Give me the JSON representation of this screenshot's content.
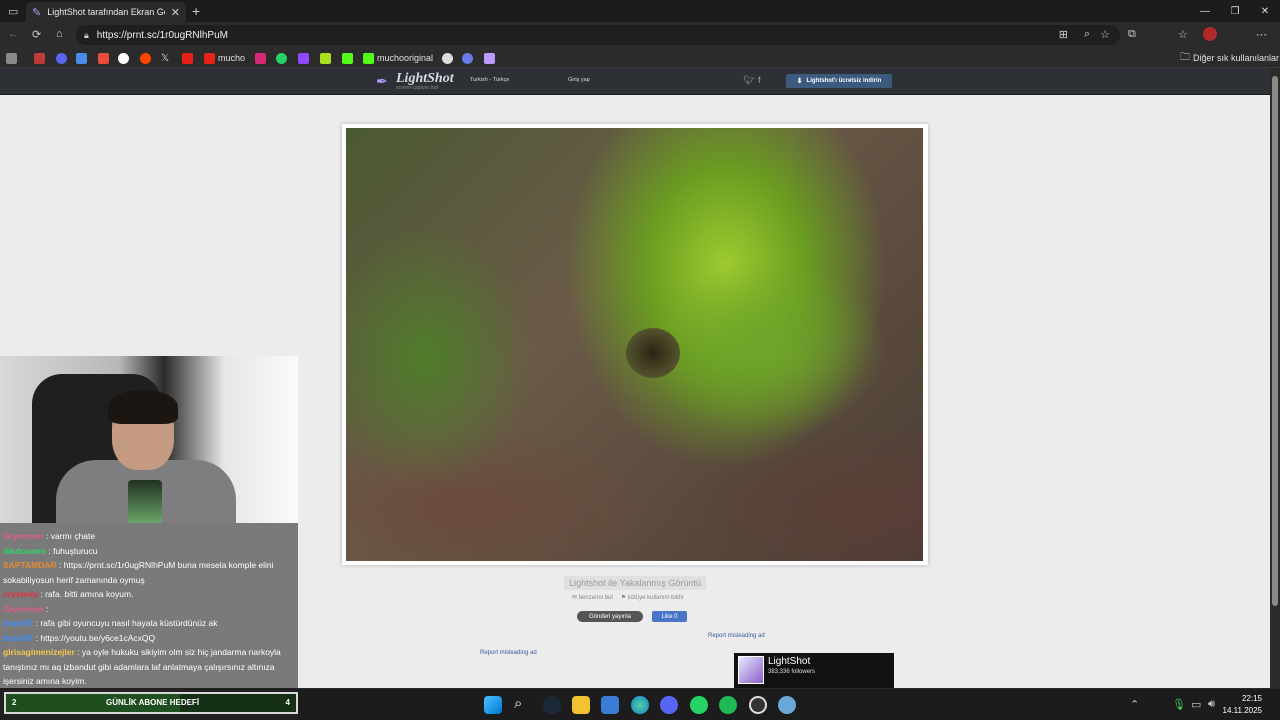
{
  "browser": {
    "tab_title": "LightShot tarafından Ekran Görüntü",
    "url": "https://prnt.sc/1r0ugRNlhPuM",
    "bookmarks": [
      "mucho",
      "muchooriginal"
    ],
    "other_bookmarks": "Diğer sık kullanılanlar",
    "colors": {
      "accent": "#3b5a7e",
      "tab_bg": "#2b2b2b"
    }
  },
  "lightshot": {
    "logo": "LightShot",
    "logo_sub": "screen capture tool",
    "language": "Turkish - Türkçe",
    "login": "Giriş yap",
    "download": "Lightshot'ı ücretsiz indirin",
    "caption": "Lightshot ile Yakalanmış Görüntü",
    "similar": "benzerini bul",
    "report_abuse": "kötüye kullanım bildir",
    "tweet": "Gönderi yayınla",
    "like": "Like 0",
    "report_ad_1": "Report misleading ad",
    "report_ad_2": "Report misleading ad",
    "fb_name": "LightShot",
    "fb_followers": "383,336 followers"
  },
  "chat": [
    {
      "user": "Gryonnnn",
      "color": "#e25a8a",
      "text": "varmı çhate"
    },
    {
      "user": "dikdonmm",
      "color": "#2fd36c",
      "text": "fuhuşturucu"
    },
    {
      "user": "SAPTAMDAR",
      "color": "#e58a2e",
      "text": "https://prnt.sc/1r0ugRNlhPuM buna mesela komple elini sokabiliyosun herif zamanında oymuş"
    },
    {
      "user": "crystedy",
      "color": "#e5303d",
      "text": "rafa. bitti amına koyum."
    },
    {
      "user": "Gryonnnn",
      "color": "#e25a8a",
      "text": ""
    },
    {
      "user": "brain97",
      "color": "#3b8cff",
      "text": "rafa gibi oyuncuyu nasıl hayata küstürdünüz ak"
    },
    {
      "user": "brain97",
      "color": "#3b8cff",
      "text": "https://youtu.be/y6ce1cAcxQQ"
    },
    {
      "user": "girisagimenizejler",
      "color": "#f4c64a",
      "text": "ya oyle hukuku sikiyim olm siz hiç jandarma narkoyla tanıştınız mı aq izbandut gibi adamlara laf anlatmaya çalışırsınız altınıza işersiniz amına koyim."
    }
  ],
  "goal": {
    "left": "2",
    "label": "GÜNLİK ABONE HEDEFİ",
    "right": "4"
  },
  "taskbar": {
    "time": "22:15",
    "date": "14.11.2025"
  }
}
